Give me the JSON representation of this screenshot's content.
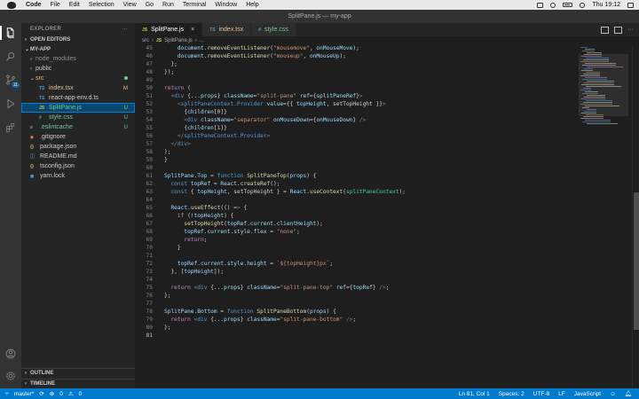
{
  "menubar": {
    "app_name": "Code",
    "items": [
      "File",
      "Edit",
      "Selection",
      "View",
      "Go",
      "Run",
      "Terminal",
      "Window",
      "Help"
    ],
    "clock": "Thu 19:12"
  },
  "window": {
    "title": "SplitPane.js — my-app"
  },
  "activity": {
    "scm_badge": "11"
  },
  "sidebar": {
    "title": "EXPLORER",
    "more": "···",
    "open_editors": "OPEN EDITORS",
    "project": "MY-APP",
    "tree": [
      {
        "label": "node_modules",
        "icon": "›",
        "status": ""
      },
      {
        "label": "public",
        "icon": "›",
        "status": ""
      },
      {
        "label": "src",
        "icon": "⌄",
        "status": "dot"
      },
      {
        "label": "index.tsx",
        "icon": "TS",
        "status": "M"
      },
      {
        "label": "react-app-env.d.ts",
        "icon": "TS",
        "status": ""
      },
      {
        "label": "SplitPane.js",
        "icon": "JS",
        "status": "U"
      },
      {
        "label": "style.css",
        "icon": "#",
        "status": "U"
      },
      {
        "label": ".eslintcache",
        "icon": "≡",
        "status": "U"
      },
      {
        "label": ".gitignore",
        "icon": "◆",
        "status": ""
      },
      {
        "label": "package.json",
        "icon": "{}",
        "status": ""
      },
      {
        "label": "README.md",
        "icon": "ⓘ",
        "status": ""
      },
      {
        "label": "tsconfig.json",
        "icon": "{}",
        "status": ""
      },
      {
        "label": "yarn.lock",
        "icon": "◼",
        "status": ""
      }
    ],
    "outline": "OUTLINE",
    "timeline": "TIMELINE"
  },
  "tabs": [
    {
      "icon": "JS",
      "label": "SplitPane.js",
      "close": "×",
      "active": true
    },
    {
      "icon": "TS",
      "label": "index.tsx",
      "active": false
    },
    {
      "icon": "#",
      "label": "style.css",
      "active": false
    }
  ],
  "breadcrumb": {
    "folder": "src",
    "sep": "›",
    "file_icon": "JS",
    "file": "SplitPane.js",
    "more": "..."
  },
  "code": {
    "first_line": 45,
    "current_line": 81,
    "lines": [
      "    document.removeEventListener(\"mousemove\", onMouseMove);",
      "    document.removeEventListener(\"mouseup\", onMouseUp);",
      "  };",
      "});",
      "",
      "return (",
      "  <div {...props} className=\"split-pane\" ref={splitPaneRef}>",
      "    <splitPaneContext.Provider value={{ topHeight, setTopHeight }}>",
      "      {children[0]}",
      "      <div className=\"separator\" onMouseDown={onMouseDown} />",
      "      {children[1]}",
      "    </splitPaneContext.Provider>",
      "  </div>",
      ");",
      "}",
      "",
      "SplitPane.Top = function SplitPaneTop(props) {",
      "  const topRef = React.createRef();",
      "  const { topHeight, setTopHeight } = React.useContext(splitPaneContext);",
      "",
      "  React.useEffect(() => {",
      "    if (!topHeight) {",
      "      setTopHeight(topRef.current.clientHeight);",
      "      topRef.current.style.flex = \"none\";",
      "      return;",
      "    }",
      "",
      "    topRef.current.style.height = `${topHeight}px`;",
      "  }, [topHeight]);",
      "",
      "  return <div {...props} className=\"split-pane-top\" ref={topRef} />;",
      "};",
      "",
      "SplitPane.Bottom = function SplitPaneBottom(props) {",
      "  return <div {...props} className=\"split-pane-bottom\" />;",
      "};",
      ""
    ]
  },
  "statusbar": {
    "branch": "master*",
    "errors": "0",
    "warnings": "0",
    "position": "Ln 81, Col 1",
    "spaces": "Spaces: 2",
    "encoding": "UTF-8",
    "eol": "LF",
    "language": "JavaScript"
  },
  "colors": {
    "accent": "#007acc",
    "selection": "#094771",
    "modified": "#e2c08d",
    "untracked": "#73c991"
  }
}
